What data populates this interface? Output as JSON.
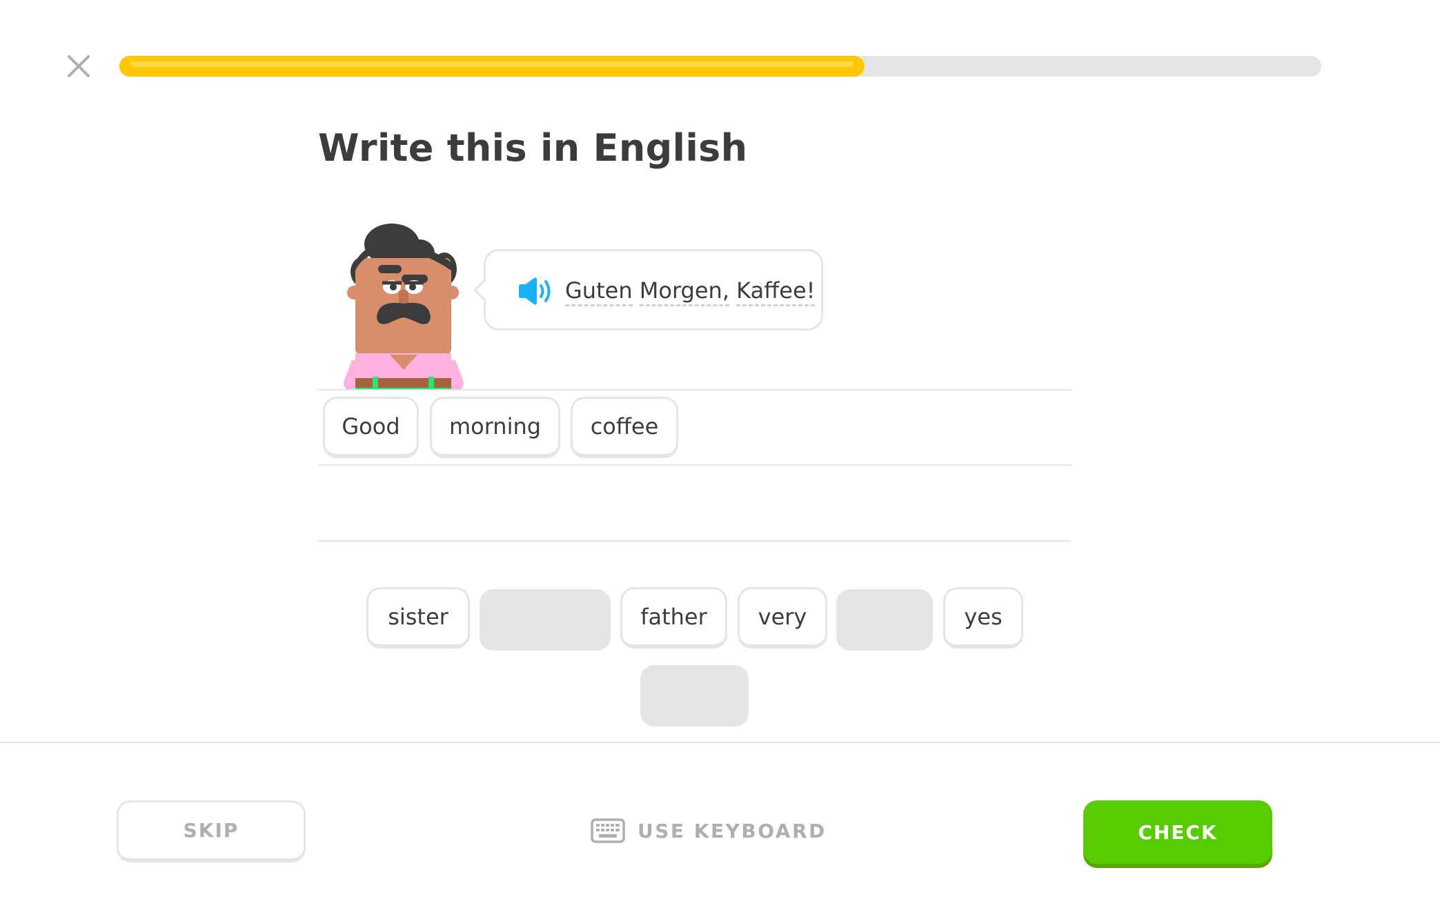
{
  "progress": {
    "fraction": 0.62,
    "color": "#ffc800",
    "track_color": "#e5e5e5"
  },
  "title": "Write this in English",
  "prompt": {
    "sentence_words": [
      "Guten",
      "Morgen,",
      "Kaffee!"
    ],
    "speaker_icon": "speaker-icon"
  },
  "answer_words": [
    "Good",
    "morning",
    "coffee"
  ],
  "word_bank": {
    "row1": [
      {
        "label": "sister",
        "used": false
      },
      {
        "label": "",
        "used": true
      },
      {
        "label": "father",
        "used": false
      },
      {
        "label": "very",
        "used": false
      },
      {
        "label": "",
        "used": true
      },
      {
        "label": "yes",
        "used": false
      }
    ],
    "row2": [
      {
        "label": "",
        "used": true
      }
    ]
  },
  "footer": {
    "skip_label": "SKIP",
    "keyboard_label": "USE KEYBOARD",
    "check_label": "CHECK",
    "check_color": "#58cc02"
  },
  "icons": {
    "close": "close-icon",
    "keyboard": "keyboard-icon"
  }
}
